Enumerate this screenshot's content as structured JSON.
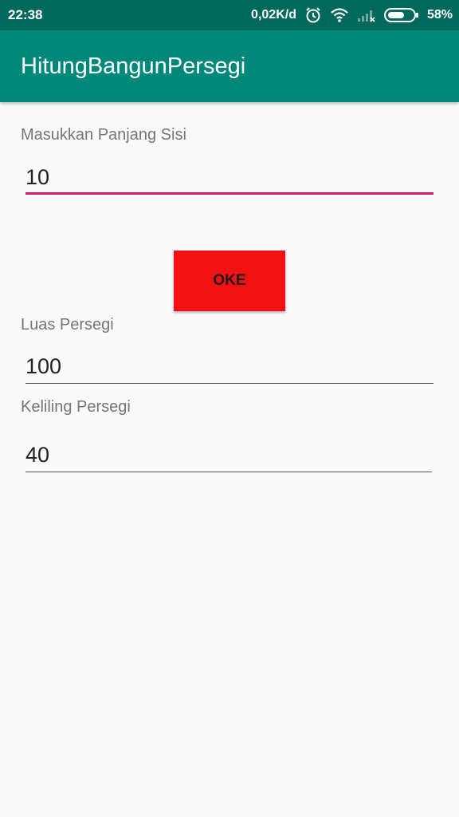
{
  "status_bar": {
    "time": "22:38",
    "network_speed": "0,02K/d",
    "battery_percent": "58%",
    "icons": [
      "alarm-icon",
      "wifi-icon",
      "signal-icon",
      "battery-icon"
    ]
  },
  "app_bar": {
    "title": "HitungBangunPersegi"
  },
  "form": {
    "side_label": "Masukkan Panjang Sisi",
    "side_value": "10",
    "ok_label": "OKE",
    "area_label": "Luas Persegi",
    "area_value": "100",
    "perimeter_label": "Keliling Persegi",
    "perimeter_value": "40"
  },
  "colors": {
    "status_bar": "#00695c",
    "app_bar": "#00897b",
    "accent": "#d81b60",
    "button": "#f21212"
  }
}
